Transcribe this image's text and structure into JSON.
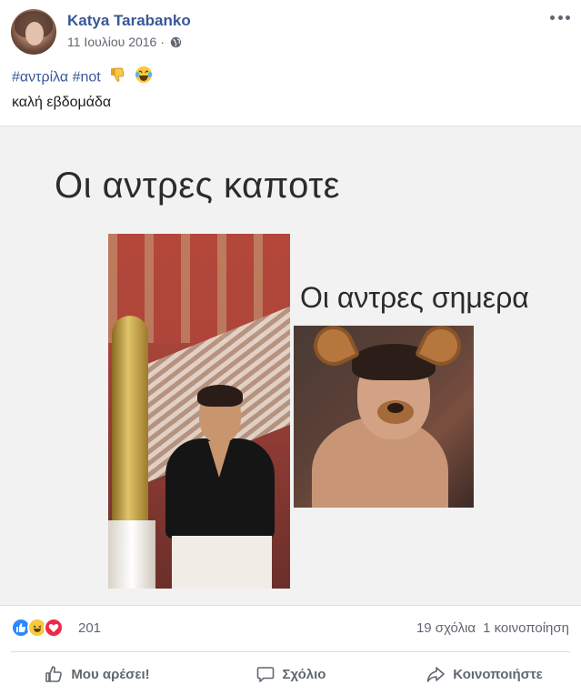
{
  "post": {
    "author": "Katya Tarabanko",
    "date": "11 Ιουλίου 2016",
    "separator": "·",
    "privacy_icon": "globe-icon",
    "more_icon": "more-options-icon",
    "hashtags": "#αντρίλα #not",
    "emojis": [
      "thumbs-down-icon",
      "laughing-tears-icon"
    ],
    "text_line_2": "καλή εβδομάδα"
  },
  "meme": {
    "caption_then": "Οι αντρες καποτε",
    "caption_now": "Οι αντρες σημερα"
  },
  "reactions": {
    "icons": [
      "like-reaction-icon",
      "haha-reaction-icon",
      "love-reaction-icon"
    ],
    "count": "201",
    "comments": "19 σχόλια",
    "shares": "1 κοινοποίηση"
  },
  "actions": {
    "like_label": "Μου αρέσει!",
    "comment_label": "Σχόλιο",
    "share_label": "Κοινοποιήστε"
  },
  "colors": {
    "link_blue": "#385898",
    "meta_gray": "#606770",
    "like_blue": "#2d88ff",
    "haha_yellow": "#f7c93e",
    "love_red": "#f0284a"
  }
}
